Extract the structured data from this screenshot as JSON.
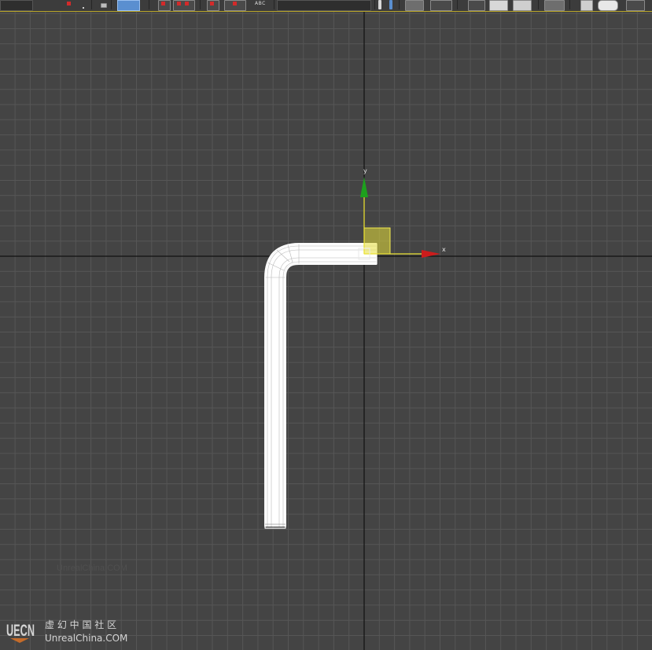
{
  "toolbar": {
    "text_label": "ABC",
    "active_color": "#5a8fd0"
  },
  "viewport": {
    "background_color": "#444444",
    "grid_color": "#565656",
    "axis_color": "#111111",
    "frame_color": "#b8a428"
  },
  "gizmo": {
    "x_label": "x",
    "y_label": "y",
    "x_color": "#cc1c1c",
    "y_color": "#1da01d",
    "plane_color": "#e8e03a"
  },
  "object": {
    "name": "bent-pipe",
    "wire_color": "#ffffff"
  },
  "watermark": {
    "faint_text": "UnrealChina.COM",
    "logo_text": "UECN",
    "chinese_text": "虚 幻 中 国 社 区",
    "site_text": "UnrealChina.COM"
  }
}
